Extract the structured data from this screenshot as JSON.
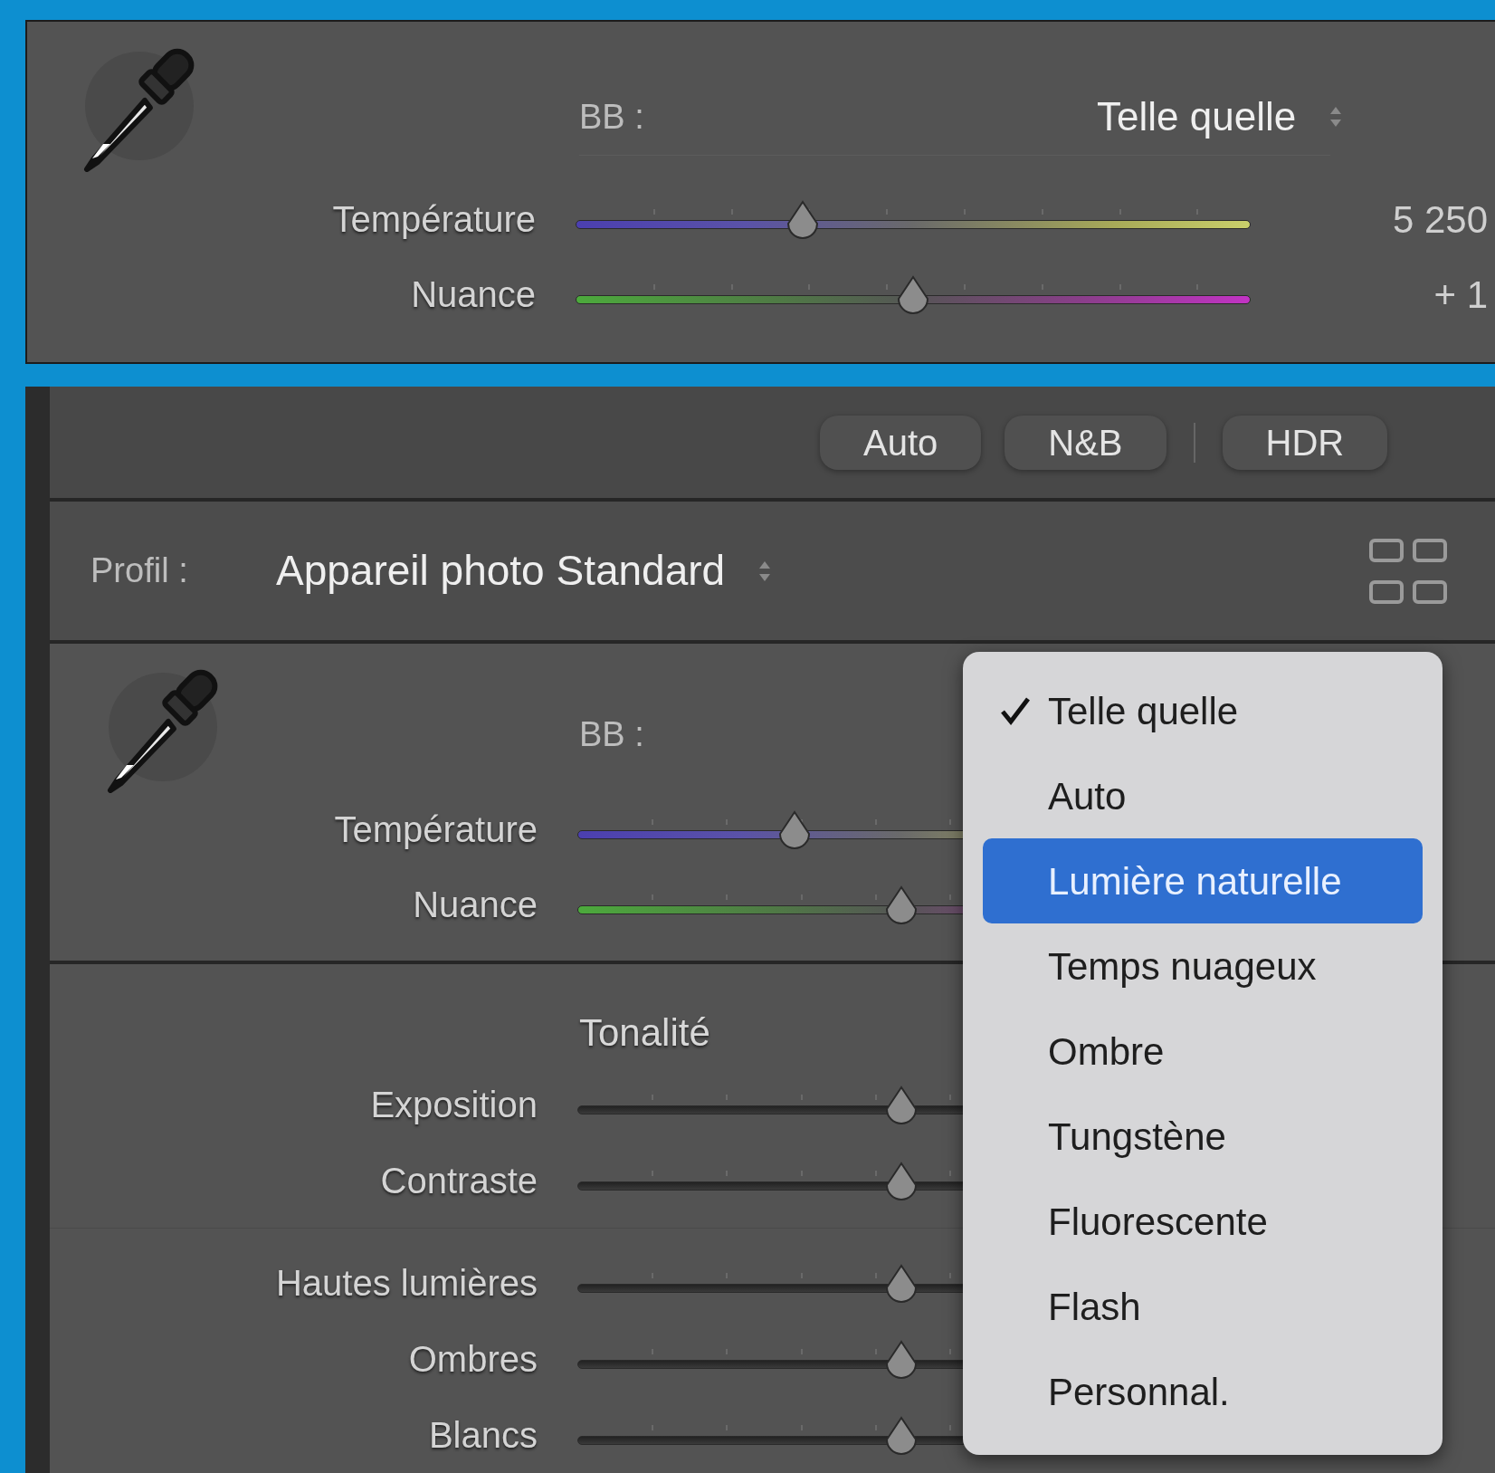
{
  "top_panel": {
    "wb_label": "BB :",
    "wb_value": "Telle quelle",
    "sliders": [
      {
        "label": "Température",
        "kind": "temperature",
        "level": 0.336,
        "reading": "5 250"
      },
      {
        "label": "Nuance",
        "kind": "tint",
        "level": 0.5,
        "reading": "+ 1"
      }
    ]
  },
  "bottom_panel": {
    "buttons": [
      {
        "label": "Auto"
      },
      {
        "label": "N&B"
      },
      {
        "label": "HDR"
      }
    ],
    "profile": {
      "label": "Profil :",
      "value": "Appareil photo Standard"
    },
    "wb_label": "BB :",
    "wb_sliders": [
      {
        "label": "Température",
        "kind": "temperature",
        "level": 0.335
      },
      {
        "label": "Nuance",
        "kind": "tint",
        "level": 0.5
      }
    ],
    "tone_heading": "Tonalité",
    "tone_groups": [
      [
        {
          "label": "Exposition",
          "level": 0.5
        },
        {
          "label": "Contraste",
          "level": 0.5
        }
      ],
      [
        {
          "label": "Hautes lumières",
          "level": 0.5
        },
        {
          "label": "Ombres",
          "level": 0.5
        },
        {
          "label": "Blancs",
          "level": 0.5
        }
      ]
    ]
  },
  "wb_menu": {
    "items": [
      {
        "label": "Telle quelle",
        "checked": true,
        "selected": false
      },
      {
        "label": "Auto",
        "checked": false,
        "selected": false
      },
      {
        "label": "Lumière naturelle",
        "checked": false,
        "selected": true
      },
      {
        "label": "Temps nuageux",
        "checked": false,
        "selected": false
      },
      {
        "label": "Ombre",
        "checked": false,
        "selected": false
      },
      {
        "label": "Tungstène",
        "checked": false,
        "selected": false
      },
      {
        "label": "Fluorescente",
        "checked": false,
        "selected": false
      },
      {
        "label": "Flash",
        "checked": false,
        "selected": false
      },
      {
        "label": "Personnal.",
        "checked": false,
        "selected": false
      }
    ]
  }
}
